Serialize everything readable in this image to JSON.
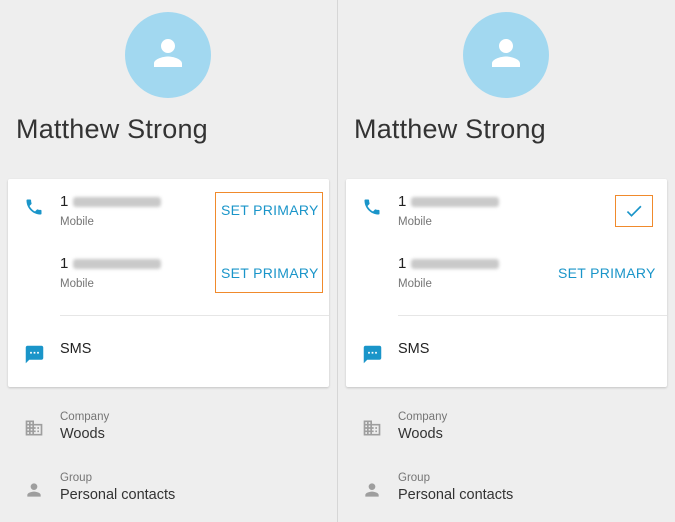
{
  "left": {
    "contact_name": "Matthew Strong",
    "phones": [
      {
        "prefix": "1",
        "kind": "Mobile",
        "action": "SET PRIMARY"
      },
      {
        "prefix": "1",
        "kind": "Mobile",
        "action": "SET PRIMARY"
      }
    ],
    "sms_label": "SMS",
    "company": {
      "label": "Company",
      "value": "Woods"
    },
    "group": {
      "label": "Group",
      "value": "Personal contacts"
    }
  },
  "right": {
    "contact_name": "Matthew Strong",
    "phones": [
      {
        "prefix": "1",
        "kind": "Mobile",
        "primary": true
      },
      {
        "prefix": "1",
        "kind": "Mobile",
        "action": "SET PRIMARY"
      }
    ],
    "sms_label": "SMS",
    "company": {
      "label": "Company",
      "value": "Woods"
    },
    "group": {
      "label": "Group",
      "value": "Personal contacts"
    }
  },
  "colors": {
    "accent": "#1a95c9",
    "avatar_bg": "#a2d8f0",
    "highlight": "#f08a2c",
    "background": "#eeeeee"
  },
  "icons": {
    "avatar": "person-icon",
    "phone": "phone-icon",
    "sms": "message-icon",
    "company": "building-icon",
    "group": "person-icon",
    "primary": "check-icon"
  }
}
